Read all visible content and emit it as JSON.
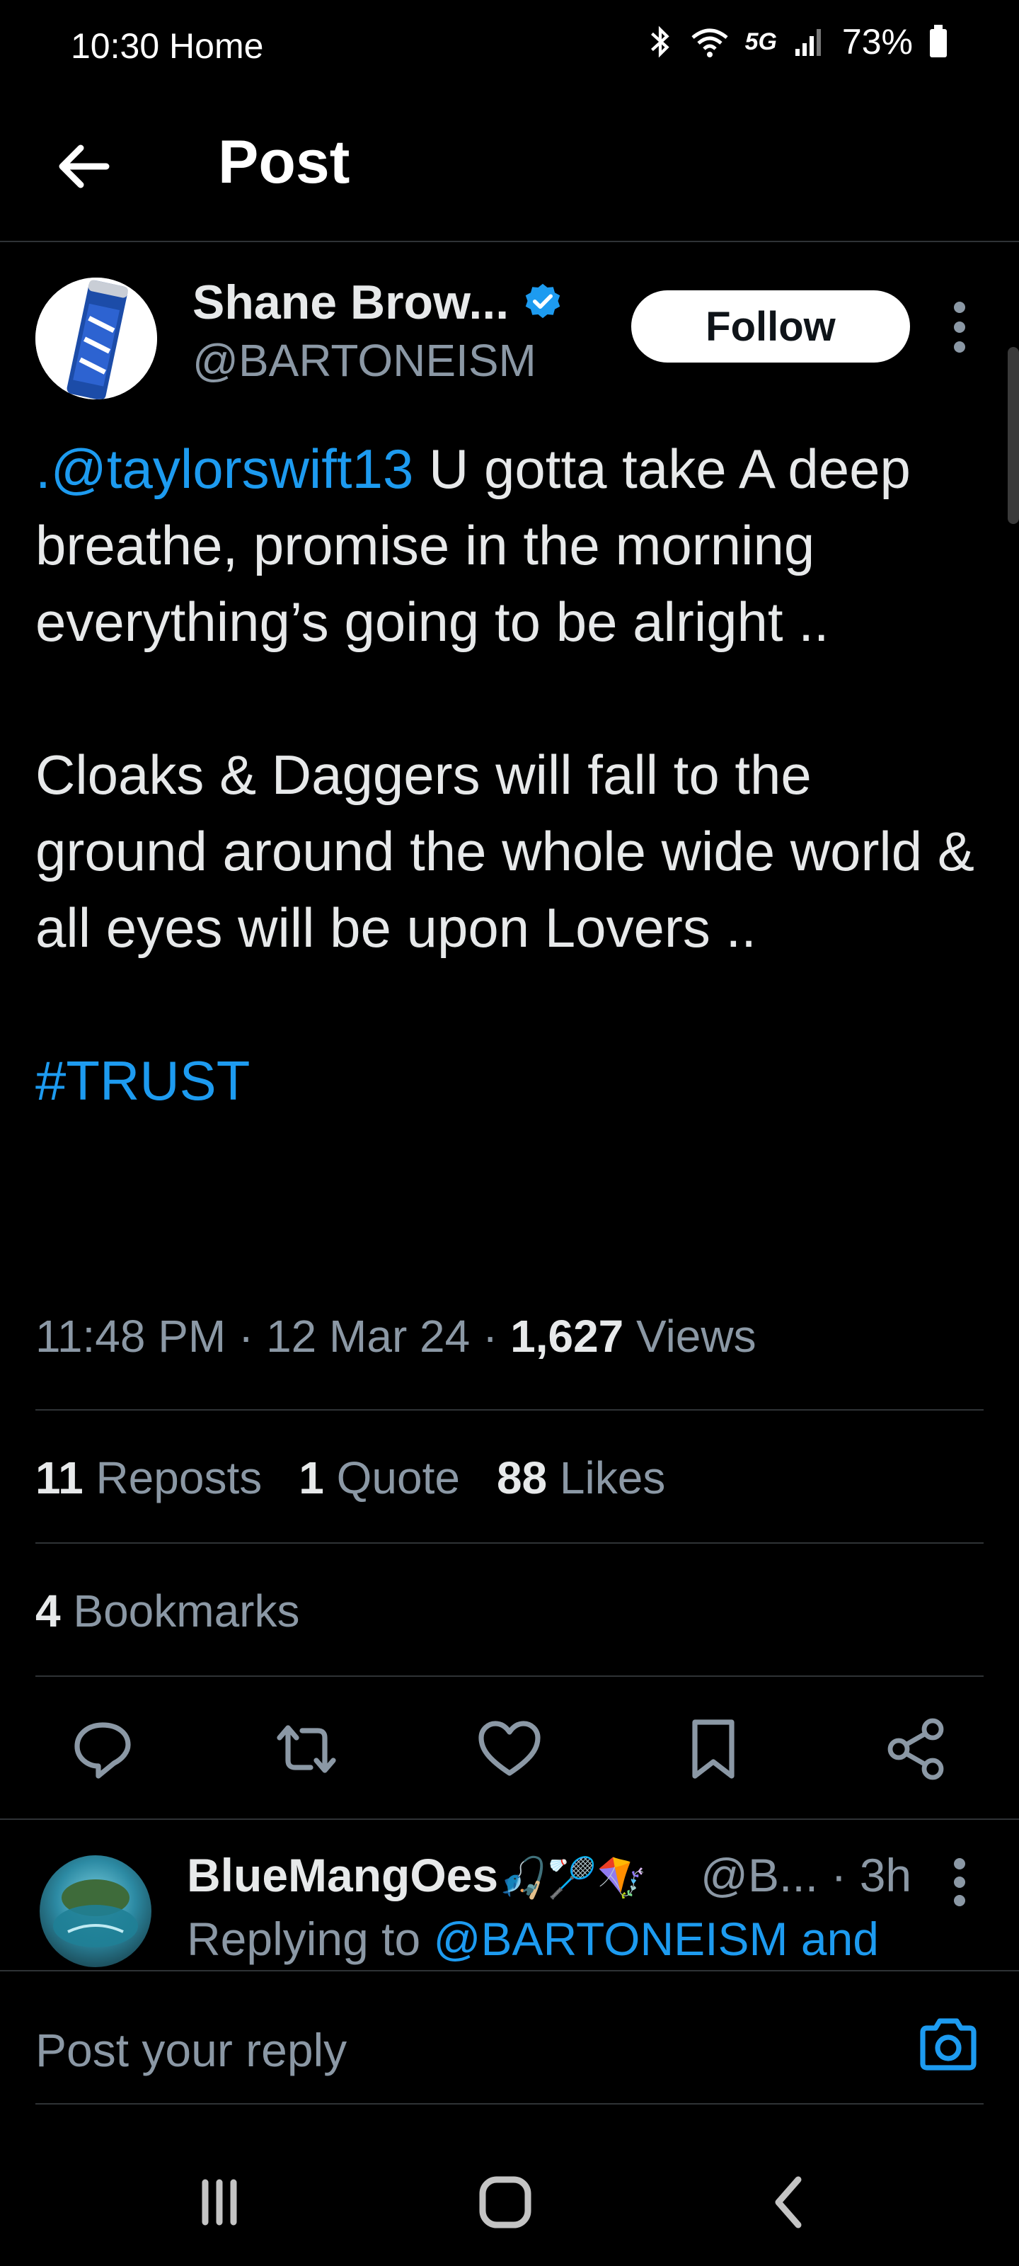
{
  "status_bar": {
    "time": "10:30",
    "label": "Home",
    "network": "5G",
    "battery": "73%",
    "icons": [
      "bluetooth-icon",
      "wifi-icon",
      "signal-icon",
      "battery-icon"
    ]
  },
  "header": {
    "title": "Post",
    "back_icon": "arrow-left-icon"
  },
  "tweet": {
    "author_name": "Shane Brow...",
    "handle": "@BARTONEISM",
    "verified": true,
    "follow_label": "Follow",
    "mention": ".@taylorswift13",
    "text_p1_rest": " U gotta take A deep breathe, promise in the morning everything’s going to be alright ..",
    "text_p2": "Cloaks & Daggers will fall to the ground around the whole wide world & all eyes will be upon Lovers ..",
    "hashtag": "#TRUST",
    "time": "11:48 PM",
    "date": "12 Mar 24",
    "views_count": "1,627",
    "views_label": "Views"
  },
  "stats": {
    "reposts_count": "11",
    "reposts_label": "Reposts",
    "quotes_count": "1",
    "quotes_label": "Quote",
    "likes_count": "88",
    "likes_label": "Likes",
    "bookmarks_count": "4",
    "bookmarks_label": "Bookmarks"
  },
  "actions": [
    "reply-icon",
    "repost-icon",
    "like-icon",
    "bookmark-icon",
    "share-icon"
  ],
  "reply_preview": {
    "name": "BlueMangOes",
    "emojis": "🎣🏸🪁",
    "handle": "@B...",
    "sep": " · ",
    "age": "3h",
    "replying_prefix": "Replying to ",
    "replying_to": "@BARTONEISM and"
  },
  "composer": {
    "placeholder": "Post your reply",
    "camera_icon": "camera-icon"
  },
  "colors": {
    "background": "#000000",
    "accent": "#1d9bf0",
    "secondary_text": "#8b98a5",
    "primary_text": "#e7e9ea"
  }
}
